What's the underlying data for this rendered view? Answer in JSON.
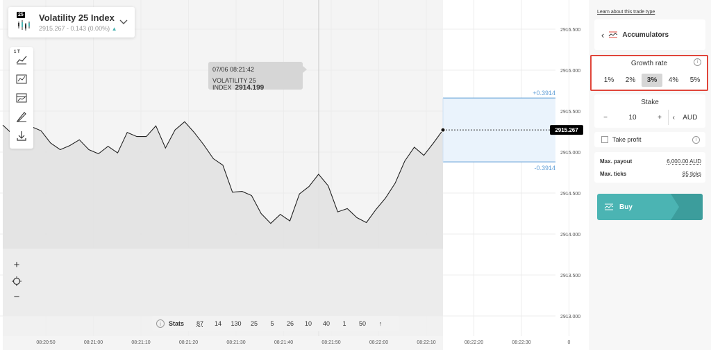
{
  "symbol": {
    "badge": "25",
    "title": "Volatility 25 Index",
    "quote": "2915.267 - 0.143 (0.00%)"
  },
  "toolbar": {
    "chart_type_label": "1 T",
    "tools": [
      "area-chart-icon",
      "indicators-icon",
      "template-icon",
      "draw-icon",
      "download-icon"
    ]
  },
  "tooltip": {
    "datetime": "07/06 08:21:42",
    "symbol": "VOLATILITY 25 INDEX",
    "value": "2914.199"
  },
  "chart_data": {
    "type": "area",
    "x_ticks": [
      "08:20:50",
      "08:21:00",
      "08:21:10",
      "08:21:20",
      "08:21:30",
      "08:21:40",
      "08:21:50",
      "08:22:00",
      "08:22:10",
      "08:22:20",
      "08:22:30",
      "0"
    ],
    "y_ticks": [
      "2916.500",
      "2916.000",
      "2915.500",
      "2915.000",
      "2914.500",
      "2914.000",
      "2913.500",
      "2913.000"
    ],
    "ylim": [
      2913,
      2916.5
    ],
    "y_tick_values": [
      2916.5,
      2916,
      2915.5,
      2915,
      2914.5,
      2914,
      2913.5,
      2913
    ],
    "series": [
      {
        "values": [
          2915.33,
          2915.22,
          2915.44,
          2915.31,
          2915.26,
          2915.11,
          2915.03,
          2915.08,
          2915.15,
          2915.03,
          2914.98,
          2915.07,
          2914.99,
          2915.24,
          2915.19,
          2915.19,
          2915.32,
          2915.05,
          2915.27,
          2915.37,
          2915.24,
          2915.09,
          2914.92,
          2914.84,
          2914.51,
          2914.52,
          2914.47,
          2914.25,
          2914.13,
          2914.24,
          2914.16,
          2914.49,
          2914.58,
          2914.73,
          2914.59,
          2914.27,
          2914.31,
          2914.2,
          2914.14,
          2914.3,
          2914.44,
          2914.62,
          2914.89,
          2915.06,
          2914.96,
          2915.11,
          2915.27
        ]
      }
    ],
    "current_price": "2915.267",
    "barrier_upper_label": "+0.3914",
    "barrier_lower_label": "-0.3914",
    "barrier_upper": 2915.66,
    "barrier_lower": 2914.88
  },
  "zoom": {
    "plus": "+",
    "minus": "−"
  },
  "stats": {
    "label": "Stats",
    "values": [
      "87",
      "14",
      "130",
      "25",
      "5",
      "26",
      "10",
      "40",
      "1",
      "50"
    ],
    "up_arrow": "↑"
  },
  "panel": {
    "learn_link": "Learn about this trade type",
    "trade_type": "Accumulators",
    "growth_title": "Growth rate",
    "growth_options": [
      "1%",
      "2%",
      "3%",
      "4%",
      "5%"
    ],
    "growth_selected": "3%",
    "stake_title": "Stake",
    "stake_minus": "−",
    "stake_value": "10",
    "stake_plus": "+",
    "currency": "AUD",
    "take_profit": "Take profit",
    "max_payout_label": "Max. payout",
    "max_payout_value": "6,000.00 AUD",
    "max_ticks_label": "Max. ticks",
    "max_ticks_value": "85 ticks",
    "buy_label": "Buy"
  },
  "colors": {
    "accent": "#4bb4b3",
    "highlight_border": "#e0453a",
    "barrier": "#5b9bd5"
  }
}
